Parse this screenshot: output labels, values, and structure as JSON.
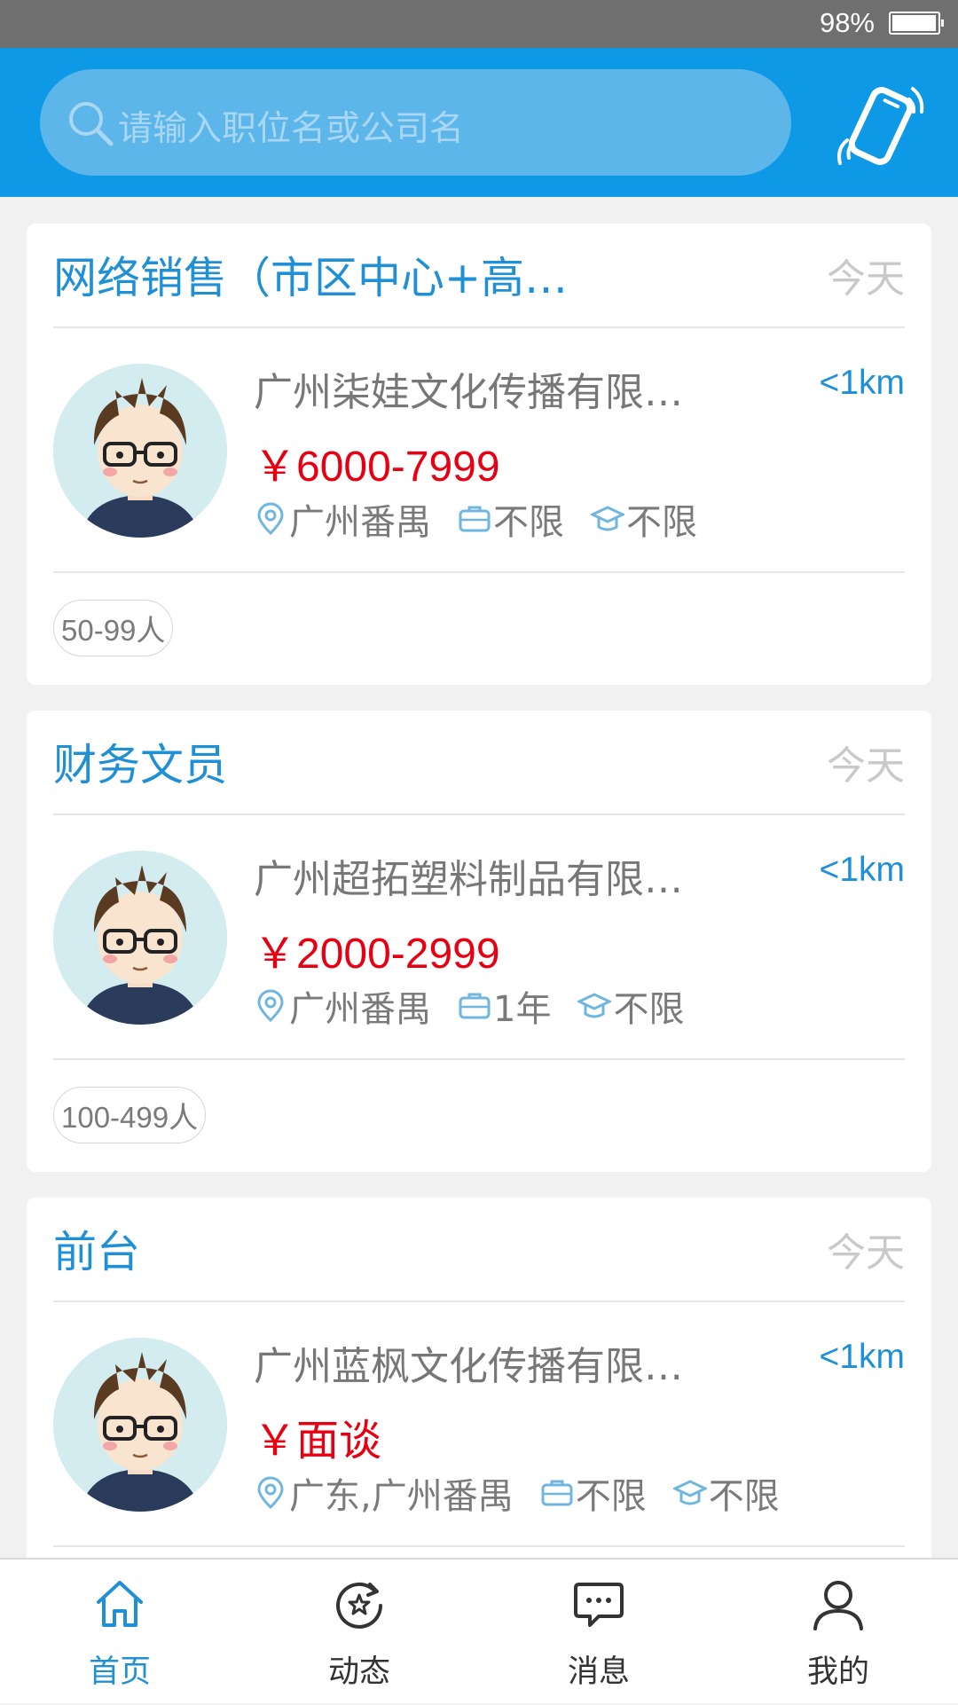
{
  "status_bar": {
    "battery_percent": "98%"
  },
  "search": {
    "placeholder": "请输入职位名或公司名"
  },
  "jobs": [
    {
      "title": "网络销售（市区中心+高…",
      "date": "今天",
      "company": "广州柒娃文化传播有限…",
      "distance": "<1km",
      "salary": "￥6000-7999",
      "location": "广州番禺",
      "experience": "不限",
      "education": "不限",
      "company_size": "50-99人"
    },
    {
      "title": "财务文员",
      "date": "今天",
      "company": "广州超拓塑料制品有限…",
      "distance": "<1km",
      "salary": "￥2000-2999",
      "location": "广州番禺",
      "experience": "1年",
      "education": "不限",
      "company_size": "100-499人"
    },
    {
      "title": "前台",
      "date": "今天",
      "company": "广州蓝枫文化传播有限…",
      "distance": "<1km",
      "salary": "￥面谈",
      "location": "广东,广州番禺",
      "experience": "不限",
      "education": "不限"
    }
  ],
  "tabs": [
    {
      "label": "首页",
      "icon": "home-icon",
      "active": true
    },
    {
      "label": "动态",
      "icon": "dynamic-icon",
      "active": false
    },
    {
      "label": "消息",
      "icon": "message-icon",
      "active": false
    },
    {
      "label": "我的",
      "icon": "profile-icon",
      "active": false
    }
  ],
  "colors": {
    "primary": "#0d99e6",
    "accent_text": "#1f90d6",
    "salary": "#e60012",
    "status_bar": "#6f6f6f"
  }
}
